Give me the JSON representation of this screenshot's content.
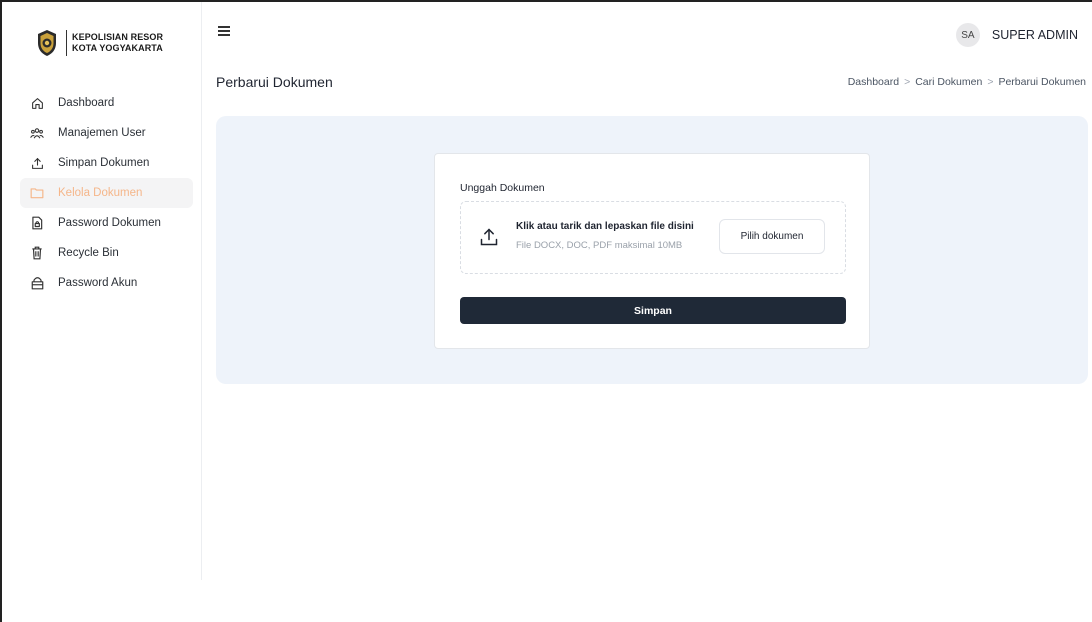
{
  "brand": {
    "line1": "KEPOLISIAN RESOR",
    "line2": "KOTA YOGYAKARTA",
    "logo_icon": "police-emblem-icon"
  },
  "sidebar": {
    "items": [
      {
        "label": "Dashboard",
        "icon": "home-icon",
        "active": false
      },
      {
        "label": "Manajemen User",
        "icon": "users-icon",
        "active": false
      },
      {
        "label": "Simpan Dokumen",
        "icon": "upload-icon",
        "active": false
      },
      {
        "label": "Kelola Dokumen",
        "icon": "folder-icon",
        "active": true
      },
      {
        "label": "Password Dokumen",
        "icon": "file-lock-icon",
        "active": false
      },
      {
        "label": "Recycle Bin",
        "icon": "trash-icon",
        "active": false
      },
      {
        "label": "Password Akun",
        "icon": "lock-icon",
        "active": false
      }
    ],
    "active_color": "#f5b68a"
  },
  "header": {
    "menu_icon": "hamburger-icon",
    "avatar_initials": "SA",
    "user_name": "SUPER ADMIN"
  },
  "page": {
    "title": "Perbarui Dokumen",
    "breadcrumb": [
      "Dashboard",
      "Cari Dokumen",
      "Perbarui Dokumen"
    ],
    "breadcrumb_separator": ">"
  },
  "form": {
    "upload_label": "Unggah Dokumen",
    "drop_title": "Klik atau tarik dan lepaskan file disini",
    "drop_hint": "File DOCX, DOC, PDF maksimal 10MB",
    "pick_button": "Pilih dokumen",
    "save_button": "Simpan"
  },
  "colors": {
    "panel_bg": "#eef3fa",
    "primary_button": "#1f2937"
  }
}
